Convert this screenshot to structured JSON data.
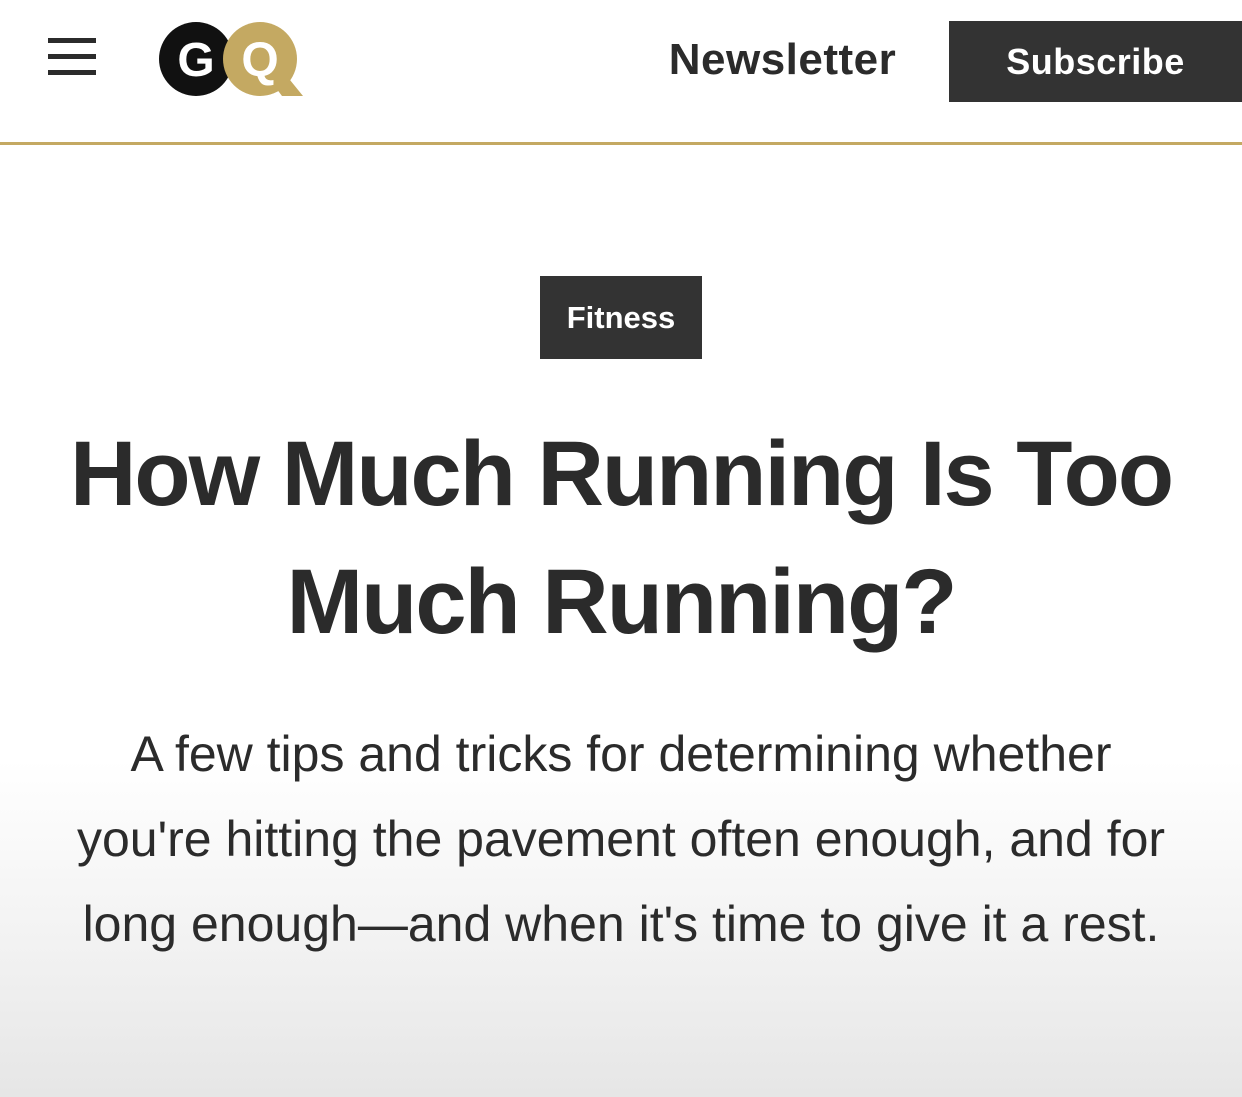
{
  "header": {
    "menu_icon": "hamburger-menu-icon",
    "logo": {
      "text": "GQ",
      "letters": [
        "G",
        "Q"
      ],
      "colors": {
        "g": "#111111",
        "q": "#c4a962"
      }
    },
    "newsletter_label": "Newsletter",
    "subscribe_label": "Subscribe",
    "accent_color": "#c4a962"
  },
  "article": {
    "category": "Fitness",
    "headline": "How Much Running Is Too Much Running?",
    "dek": "A few tips and tricks for determining whether you're hitting the pavement often enough, and for long enough—and when it's time to give it a rest."
  }
}
